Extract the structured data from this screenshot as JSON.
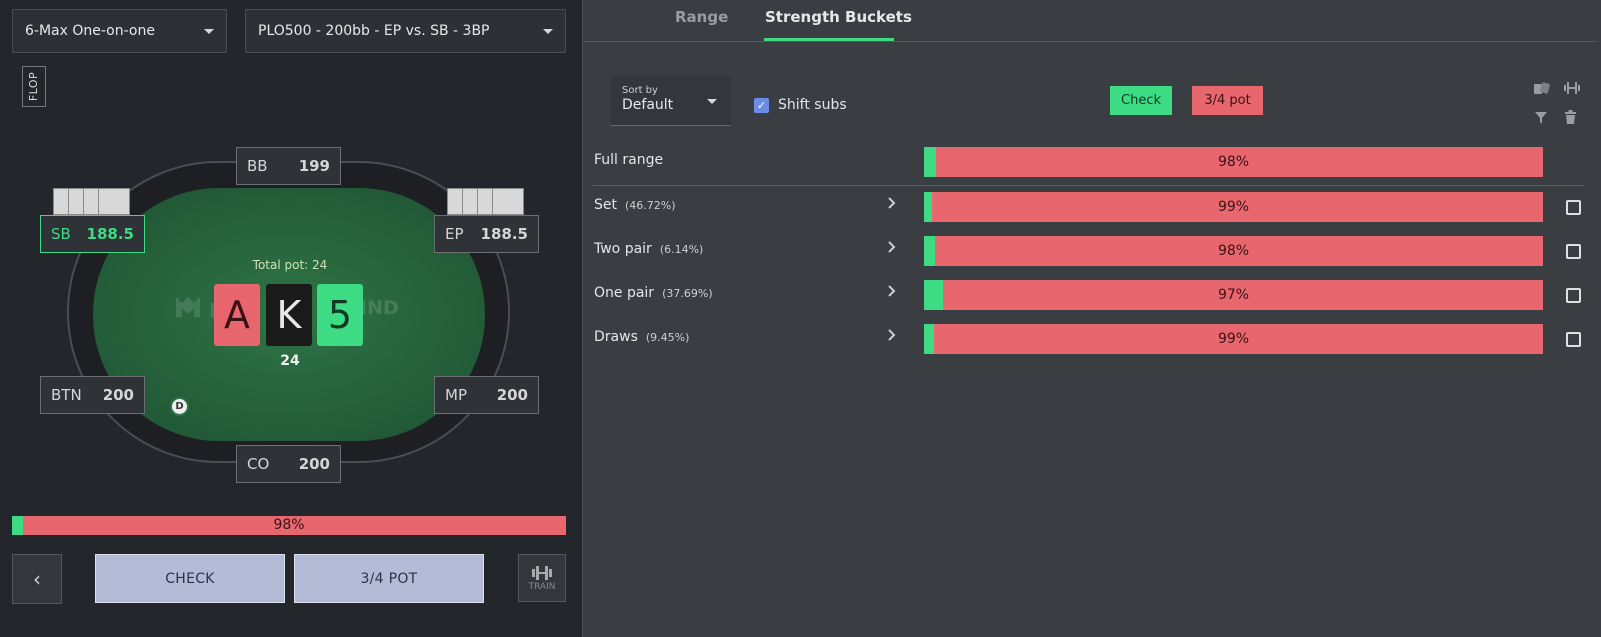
{
  "left": {
    "game_select": "6-Max One-on-one",
    "spot_select": "PLO500 - 200bb - EP vs. SB - 3BP",
    "street": "FLOP",
    "seats": {
      "bb": {
        "pos": "BB",
        "stack": "199"
      },
      "sb": {
        "pos": "SB",
        "stack": "188.5"
      },
      "ep": {
        "pos": "EP",
        "stack": "188.5"
      },
      "btn": {
        "pos": "BTN",
        "stack": "200"
      },
      "mp": {
        "pos": "MP",
        "stack": "200"
      },
      "co": {
        "pos": "CO",
        "stack": "200"
      }
    },
    "total_pot": "Total pot: 24",
    "watermark": "ND",
    "watermark_end": "IND",
    "board": [
      "A",
      "K",
      "5"
    ],
    "pot_amount": "24",
    "dealer": "D",
    "strategy_bar": {
      "check_fraction": 0.02,
      "label": "98%"
    },
    "buttons": {
      "back": "‹",
      "check": "CHECK",
      "pot": "3/4 POT",
      "train": "TRAIN"
    }
  },
  "right": {
    "tabs": {
      "range": "Range",
      "buckets": "Strength Buckets"
    },
    "sort": {
      "label": "Sort by",
      "value": "Default"
    },
    "shift_subs": "Shift subs",
    "legend": {
      "check": "Check",
      "pot": "3/4 pot"
    },
    "rows": [
      {
        "label": "Full range",
        "pct": "",
        "check_fraction": 0.02,
        "bar_label": "98%"
      },
      {
        "label": "Set",
        "pct": "(46.72%)",
        "check_fraction": 0.013,
        "bar_label": "99%"
      },
      {
        "label": "Two pair",
        "pct": "(6.14%)",
        "check_fraction": 0.017,
        "bar_label": "98%"
      },
      {
        "label": "One pair",
        "pct": "(37.69%)",
        "check_fraction": 0.03,
        "bar_label": "97%"
      },
      {
        "label": "Draws",
        "pct": "(9.45%)",
        "check_fraction": 0.016,
        "bar_label": "99%"
      }
    ]
  },
  "colors": {
    "check": "#3ddc84",
    "pot": "#e8676e",
    "accent": "#3ddc84"
  }
}
